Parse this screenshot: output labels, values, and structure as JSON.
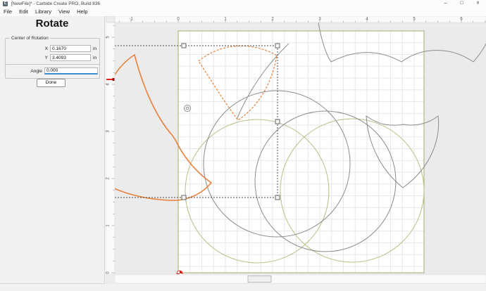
{
  "window": {
    "title": "[NewFile]* - Carbide Create PRO, Build 836",
    "icon": "C",
    "minimize": "–",
    "maximize": "□",
    "close": "×"
  },
  "menu": {
    "items": [
      "File",
      "Edit",
      "Library",
      "View",
      "Help"
    ]
  },
  "panel": {
    "title": "Rotate",
    "center_group": {
      "label": "Center of Rotation",
      "x_label": "X",
      "x_value": "0.1670",
      "x_unit": "in",
      "y_label": "Y",
      "y_value": "3.4093",
      "y_unit": "in"
    },
    "angle_label": "Angle",
    "angle_value": "0.000",
    "done_label": "Done"
  },
  "rulers": {
    "top_labels": [
      "-1",
      "0",
      "1",
      "2",
      "3",
      "4",
      "5",
      "6"
    ],
    "top_values": [
      -1,
      0,
      1,
      2,
      3,
      4,
      5,
      6
    ],
    "left_labels": [
      "0",
      "1",
      "2",
      "3",
      "4",
      "5"
    ],
    "left_values": [
      0,
      1,
      2,
      3,
      4,
      5
    ]
  },
  "colors": {
    "selected_orange": "#e8813c",
    "vector_gray": "#8c8c8c",
    "vector_olive": "#bdbd8a",
    "grid": "#e7e7e7",
    "job_border": "#a9a96d",
    "viewport_bg": "#ebebeb",
    "ruler_bg": "#fafafa",
    "selection": "#4a4a4a",
    "origin_red": "#dd1111",
    "ruler_marker_red": "#e82222"
  }
}
